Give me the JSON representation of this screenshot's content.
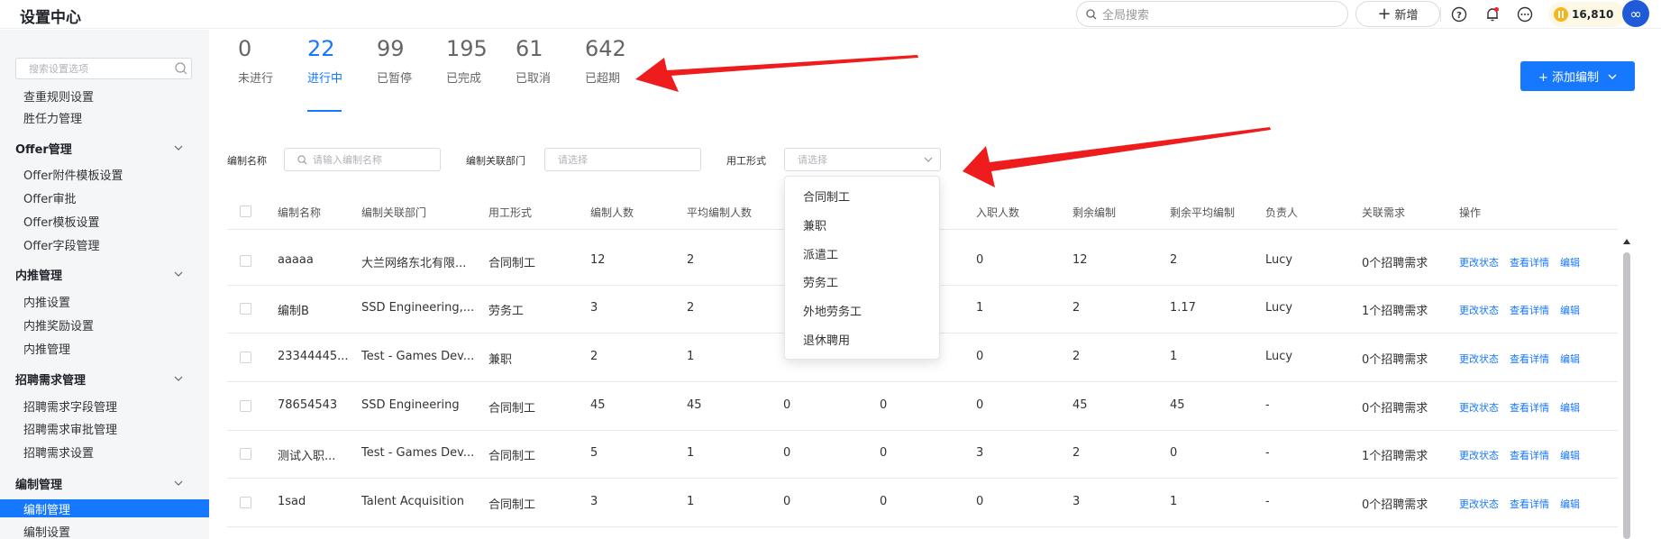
{
  "header": {
    "title": "设置中心",
    "search_placeholder": "全局搜索",
    "new_label": "新增",
    "coins": "16,810",
    "avatar_text": "∞"
  },
  "sidebar": {
    "search_placeholder": "搜索设置选项",
    "items": [
      {
        "type": "item",
        "label": "查重规则设置"
      },
      {
        "type": "item",
        "label": "胜任力管理"
      },
      {
        "type": "group",
        "label": "Offer管理"
      },
      {
        "type": "item",
        "label": "Offer附件模板设置"
      },
      {
        "type": "item",
        "label": "Offer审批"
      },
      {
        "type": "item",
        "label": "Offer模板设置"
      },
      {
        "type": "item",
        "label": "Offer字段管理"
      },
      {
        "type": "group",
        "label": "内推管理"
      },
      {
        "type": "item",
        "label": "内推设置"
      },
      {
        "type": "item",
        "label": "内推奖励设置"
      },
      {
        "type": "item",
        "label": "内推管理"
      },
      {
        "type": "group",
        "label": "招聘需求管理"
      },
      {
        "type": "item",
        "label": "招聘需求字段管理"
      },
      {
        "type": "item",
        "label": "招聘需求审批管理"
      },
      {
        "type": "item",
        "label": "招聘需求设置"
      },
      {
        "type": "group",
        "label": "编制管理"
      },
      {
        "type": "item",
        "label": "编制管理",
        "active": true
      },
      {
        "type": "item",
        "label": "编制设置"
      }
    ]
  },
  "stats": [
    {
      "num": "0",
      "label": "未进行"
    },
    {
      "num": "22",
      "label": "进行中",
      "active": true
    },
    {
      "num": "99",
      "label": "已暂停"
    },
    {
      "num": "195",
      "label": "已完成"
    },
    {
      "num": "61",
      "label": "已取消"
    },
    {
      "num": "642",
      "label": "已超期"
    }
  ],
  "add_button": "+ 添加编制",
  "filters": {
    "name_label": "编制名称",
    "name_placeholder": "请输入编制名称",
    "dept_label": "编制关联部门",
    "dept_placeholder": "请选择",
    "type_label": "用工形式",
    "type_placeholder": "请选择"
  },
  "dropdown_options": [
    "合同制工",
    "兼职",
    "派遣工",
    "劳务工",
    "外地劳务工",
    "退休聘用"
  ],
  "table": {
    "headers": [
      "编制名称",
      "编制关联部门",
      "用工形式",
      "编制人数",
      "平均编制人数",
      "入职人数",
      "剩余编制",
      "剩余平均编制",
      "负责人",
      "关联需求",
      "操作"
    ],
    "actions": [
      "更改状态",
      "查看详情",
      "编辑"
    ],
    "rows": [
      {
        "name": "aaaaa",
        "dept": "大兰网络东北有限...",
        "type": "合同制工",
        "count": "12",
        "avg": "2",
        "c3": "",
        "c4": "",
        "joined": "0",
        "remain": "12",
        "remain_avg": "2",
        "owner": "Lucy",
        "req": "0个招聘需求"
      },
      {
        "name": "编制B",
        "dept": "SSD Engineering,...",
        "type": "劳务工",
        "count": "3",
        "avg": "2",
        "c3": "",
        "c4": "",
        "joined": "1",
        "remain": "2",
        "remain_avg": "1.17",
        "owner": "Lucy",
        "req": "1个招聘需求"
      },
      {
        "name": "23344445...",
        "dept": "Test - Games Dev...",
        "type": "兼职",
        "count": "2",
        "avg": "1",
        "c3": "",
        "c4": "",
        "joined": "0",
        "remain": "2",
        "remain_avg": "1",
        "owner": "Lucy",
        "req": "0个招聘需求"
      },
      {
        "name": "78654543",
        "dept": "SSD Engineering",
        "type": "合同制工",
        "count": "45",
        "avg": "45",
        "c3": "0",
        "c4": "0",
        "joined": "0",
        "remain": "45",
        "remain_avg": "45",
        "owner": "-",
        "req": "0个招聘需求"
      },
      {
        "name": "测试入职...",
        "dept": "Test - Games Dev...",
        "type": "合同制工",
        "count": "5",
        "avg": "1",
        "c3": "0",
        "c4": "0",
        "joined": "3",
        "remain": "2",
        "remain_avg": "0",
        "owner": "-",
        "req": "1个招聘需求"
      },
      {
        "name": "1sad",
        "dept": "Talent Acquisition",
        "type": "合同制工",
        "count": "3",
        "avg": "1",
        "c3": "0",
        "c4": "0",
        "joined": "0",
        "remain": "3",
        "remain_avg": "1",
        "owner": "-",
        "req": "0个招聘需求"
      }
    ]
  },
  "colors": {
    "accent": "#1677ff",
    "arrow": "#ee1c1c"
  }
}
